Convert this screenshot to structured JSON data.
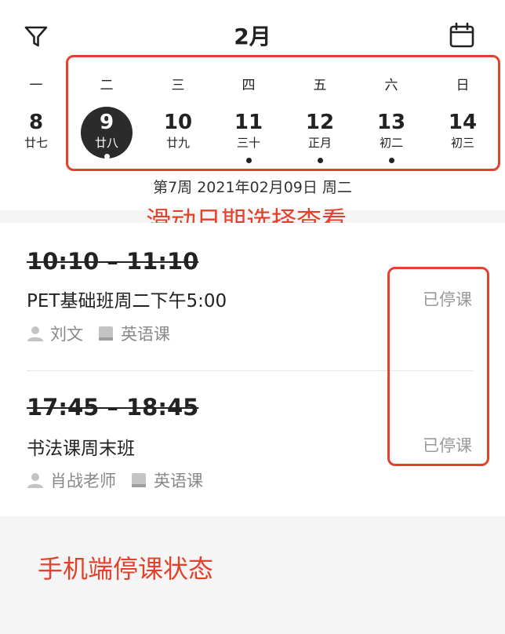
{
  "header": {
    "month": "2月"
  },
  "week": {
    "weekdays": [
      "一",
      "二",
      "三",
      "四",
      "五",
      "六",
      "日"
    ],
    "days": [
      {
        "num": "8",
        "lunar": "廿七",
        "has_event": false,
        "selected": false
      },
      {
        "num": "9",
        "lunar": "廿八",
        "has_event": true,
        "selected": true
      },
      {
        "num": "10",
        "lunar": "廿九",
        "has_event": false,
        "selected": false
      },
      {
        "num": "11",
        "lunar": "三十",
        "has_event": true,
        "selected": false
      },
      {
        "num": "12",
        "lunar": "正月",
        "has_event": true,
        "selected": false
      },
      {
        "num": "13",
        "lunar": "初二",
        "has_event": true,
        "selected": false
      },
      {
        "num": "14",
        "lunar": "初三",
        "has_event": false,
        "selected": false
      }
    ],
    "info": "第7周 2021年02月09日 周二"
  },
  "annotations": {
    "swipe_hint": "滑动日期选择查看",
    "status_hint": "手机端停课状态",
    "color": "#e2422b"
  },
  "courses": [
    {
      "time": "10:10 – 11:10",
      "name": "PET基础班周二下午5:00",
      "teacher": "刘文",
      "subject": "英语课",
      "status": "已停课"
    },
    {
      "time": "17:45 – 18:45",
      "name": "书法课周末班",
      "teacher": "肖战老师",
      "subject": "英语课",
      "status": "已停课"
    }
  ]
}
